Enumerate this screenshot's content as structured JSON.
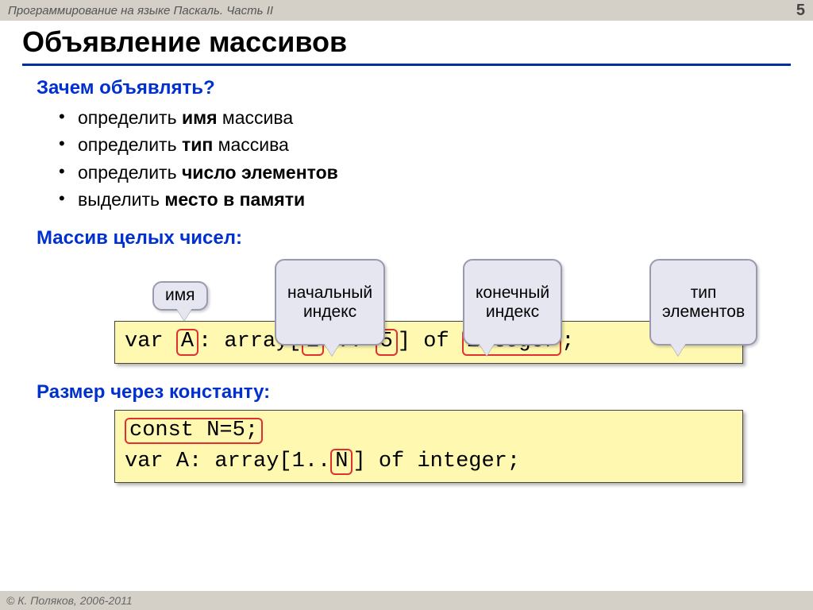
{
  "header": {
    "course": "Программирование на языке Паскаль. Часть II",
    "page": "5"
  },
  "title": "Объявление массивов",
  "why": {
    "heading": "Зачем объявлять?",
    "items": [
      {
        "pre": "определить ",
        "b": "имя",
        "post": " массива"
      },
      {
        "pre": "определить ",
        "b": "тип",
        "post": " массива"
      },
      {
        "pre": "определить ",
        "b": "число элементов",
        "post": ""
      },
      {
        "pre": "выделить ",
        "b": "место в памяти",
        "post": ""
      }
    ]
  },
  "intArr": {
    "heading": "Массив целых чисел:",
    "callouts": {
      "name": "имя",
      "startIdx": "начальный\nиндекс",
      "endIdx": "конечный\nиндекс",
      "elemType": "тип\nэлементов"
    },
    "code": {
      "p0": "var ",
      "hl0": "A",
      "p1": ": array[",
      "hl1": "1",
      "p2": " .. ",
      "hl2": "5",
      "p3": "] of ",
      "hl3": "integer",
      "p4": ";"
    }
  },
  "constSz": {
    "heading": "Размер через константу:",
    "code": {
      "line1": "const N=5;",
      "p0": "var A: array[1..",
      "hlN": "N",
      "p1": "] of integer;"
    }
  },
  "footer": "© К. Поляков, 2006-2011"
}
